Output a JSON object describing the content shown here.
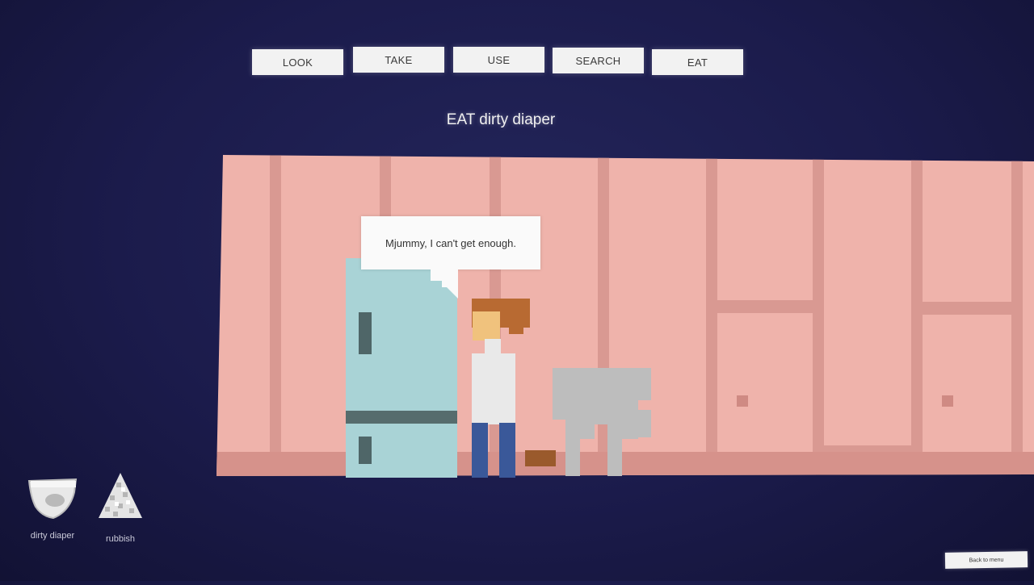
{
  "verbs": {
    "look": "LOOK",
    "take": "TAKE",
    "use": "USE",
    "search": "SEARCH",
    "eat": "EAT"
  },
  "status_line": "EAT dirty diaper",
  "speech": {
    "text": "Mjummy, I can't get enough."
  },
  "inventory": [
    {
      "label": "dirty diaper",
      "icon": "diaper-icon"
    },
    {
      "label": "rubbish",
      "icon": "rubbish-icon"
    }
  ],
  "back_button": "Back to menu",
  "colors": {
    "background": "#1b1b4b",
    "wall": "#efb3ab",
    "wall_stripe": "#d28f88",
    "fridge": "#a9d3d6",
    "fridge_trim": "#4f6668",
    "dog": "#bdbdbd",
    "hair": "#b86a32",
    "skin": "#f0c27d",
    "shirt": "#e9e9e9",
    "jeans": "#3a5899"
  }
}
